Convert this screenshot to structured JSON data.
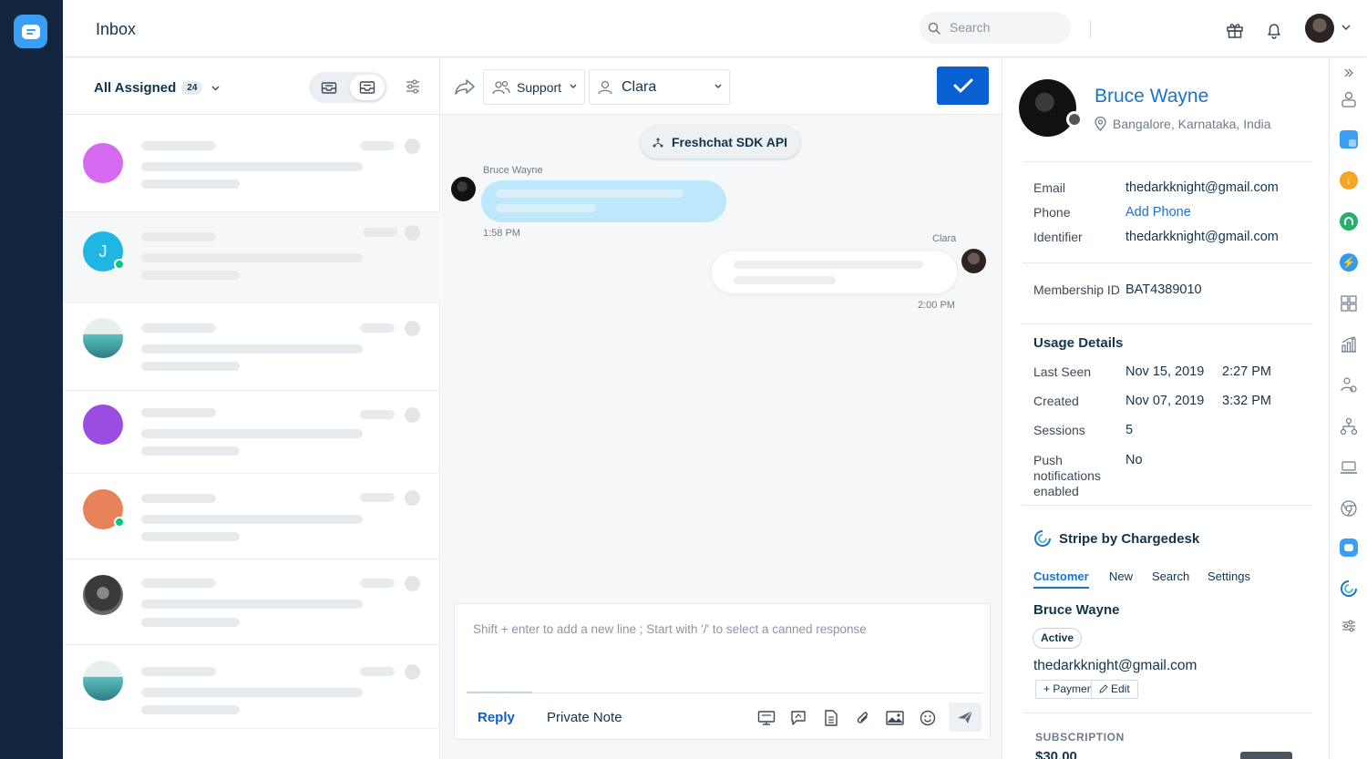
{
  "header": {
    "title": "Inbox",
    "search_placeholder": "Search"
  },
  "conversation_list": {
    "filter_label": "All Assigned",
    "count": "24",
    "avatar_colors": [
      "#d46af0",
      "#1fb6e3",
      "#5dbfc0",
      "#9b4de0",
      "#e8825a",
      "#4a4a4a",
      "#5dbfc0"
    ],
    "selected_avatar_letter": "J"
  },
  "chat": {
    "group": "Support",
    "agent": "Clara",
    "source": "Freshchat SDK API",
    "incoming": {
      "sender": "Bruce Wayne",
      "time": "1:58 PM"
    },
    "outgoing": {
      "sender": "Clara",
      "time": "2:00 PM"
    },
    "composer_placeholder": "Shift + enter to add a new line ; Start with '/' to select a canned response",
    "tab_reply": "Reply",
    "tab_private_note": "Private Note"
  },
  "contact": {
    "name": "Bruce Wayne",
    "location": "Bangalore, Karnataka, India",
    "email_label": "Email",
    "email": "thedarkknight@gmail.com",
    "phone_label": "Phone",
    "phone_action": "Add Phone",
    "identifier_label": "Identifier",
    "identifier": "thedarkknight@gmail.com",
    "membership_label": "Membership ID",
    "membership": "BAT4389010",
    "usage_title": "Usage Details",
    "last_seen_label": "Last Seen",
    "last_seen_date": "Nov 15, 2019",
    "last_seen_time": "2:27 PM",
    "created_label": "Created",
    "created_date": "Nov 07, 2019",
    "created_time": "3:32 PM",
    "sessions_label": "Sessions",
    "sessions": "5",
    "push_label": "Push notifications enabled",
    "push": "No"
  },
  "stripe": {
    "title": "Stripe by Chargedesk",
    "tabs": [
      "Customer",
      "New",
      "Search",
      "Settings"
    ],
    "customer_name": "Bruce Wayne",
    "status": "Active",
    "email": "thedarkknight@gmail.com",
    "payment_button": "+ Payment",
    "edit_button": "Edit",
    "subscription_label": "SUBSCRIPTION",
    "amount": "$30.00"
  },
  "colors": {
    "nav_bg": "#12253f",
    "accent": "#0a5fd1",
    "link": "#1a73c9",
    "incoming_bubble": "#bde7fb",
    "online": "#00c781"
  }
}
